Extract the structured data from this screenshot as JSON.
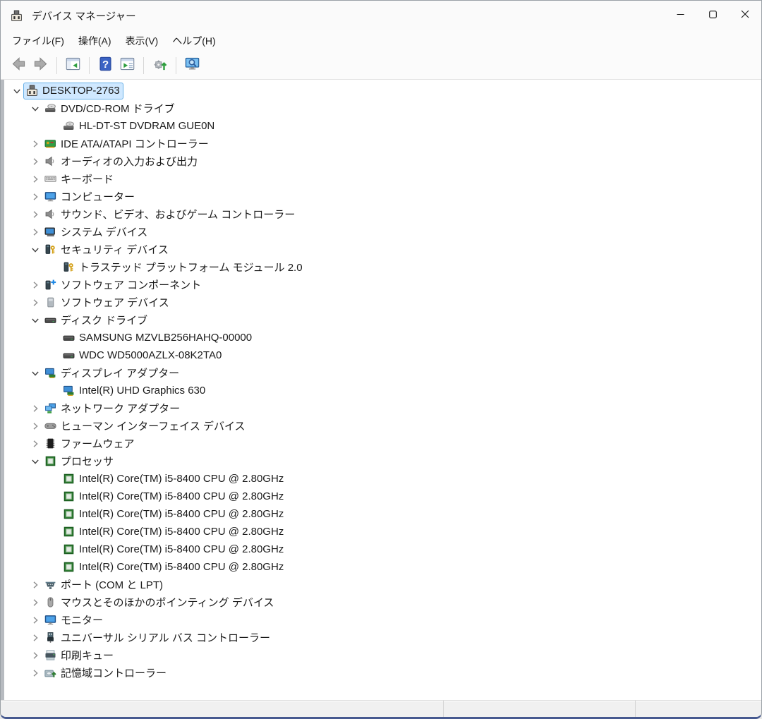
{
  "window": {
    "title": "デバイス マネージャー",
    "controls": [
      {
        "name": "minimize-button",
        "icon": "minimize-icon"
      },
      {
        "name": "maximize-button",
        "icon": "maximize-icon"
      },
      {
        "name": "close-button",
        "icon": "close-icon"
      }
    ]
  },
  "menu": {
    "items": [
      {
        "label": "ファイル(F)"
      },
      {
        "label": "操作(A)"
      },
      {
        "label": "表示(V)"
      },
      {
        "label": "ヘルプ(H)"
      }
    ]
  },
  "toolbar": {
    "items": [
      {
        "type": "button",
        "icon": "back-arrow-icon"
      },
      {
        "type": "button",
        "icon": "forward-arrow-icon"
      },
      {
        "type": "separator"
      },
      {
        "type": "button",
        "icon": "show-console-tree-icon"
      },
      {
        "type": "separator"
      },
      {
        "type": "button",
        "icon": "help-icon"
      },
      {
        "type": "button",
        "icon": "properties-icon"
      },
      {
        "type": "separator"
      },
      {
        "type": "button",
        "icon": "update-driver-icon"
      },
      {
        "type": "separator"
      },
      {
        "type": "button",
        "icon": "scan-hardware-changes-icon"
      }
    ]
  },
  "tree": {
    "items": [
      {
        "level": 0,
        "expander": "expanded",
        "icon": "computer-device-icon",
        "label": "DESKTOP-2763",
        "selected": true
      },
      {
        "level": 1,
        "expander": "expanded",
        "icon": "dvd-drive-icon",
        "label": "DVD/CD-ROM ドライブ"
      },
      {
        "level": 2,
        "expander": "none",
        "icon": "dvd-drive-icon",
        "label": "HL-DT-ST DVDRAM GUE0N"
      },
      {
        "level": 1,
        "expander": "collapsed",
        "icon": "ide-controller-icon",
        "label": "IDE ATA/ATAPI コントローラー"
      },
      {
        "level": 1,
        "expander": "collapsed",
        "icon": "speaker-icon",
        "label": "オーディオの入力および出力"
      },
      {
        "level": 1,
        "expander": "collapsed",
        "icon": "keyboard-icon",
        "label": "キーボード"
      },
      {
        "level": 1,
        "expander": "collapsed",
        "icon": "blue-monitor-icon",
        "label": "コンピューター"
      },
      {
        "level": 1,
        "expander": "collapsed",
        "icon": "speaker-icon",
        "label": "サウンド、ビデオ、およびゲーム コントローラー"
      },
      {
        "level": 1,
        "expander": "collapsed",
        "icon": "system-device-icon",
        "label": "システム デバイス"
      },
      {
        "level": 1,
        "expander": "expanded",
        "icon": "security-device-icon",
        "label": "セキュリティ デバイス"
      },
      {
        "level": 2,
        "expander": "none",
        "icon": "security-device-icon",
        "label": "トラステッド プラットフォーム モジュール 2.0"
      },
      {
        "level": 1,
        "expander": "collapsed",
        "icon": "software-component-icon",
        "label": "ソフトウェア コンポーネント"
      },
      {
        "level": 1,
        "expander": "collapsed",
        "icon": "software-device-icon",
        "label": "ソフトウェア デバイス"
      },
      {
        "level": 1,
        "expander": "expanded",
        "icon": "disk-drive-icon",
        "label": "ディスク ドライブ"
      },
      {
        "level": 2,
        "expander": "none",
        "icon": "disk-drive-icon",
        "label": "SAMSUNG MZVLB256HAHQ-00000"
      },
      {
        "level": 2,
        "expander": "none",
        "icon": "disk-drive-icon",
        "label": "WDC WD5000AZLX-08K2TA0"
      },
      {
        "level": 1,
        "expander": "expanded",
        "icon": "display-adapter-icon",
        "label": "ディスプレイ アダプター"
      },
      {
        "level": 2,
        "expander": "none",
        "icon": "display-adapter-icon",
        "label": "Intel(R) UHD Graphics 630"
      },
      {
        "level": 1,
        "expander": "collapsed",
        "icon": "network-adapter-icon",
        "label": "ネットワーク アダプター"
      },
      {
        "level": 1,
        "expander": "collapsed",
        "icon": "hid-icon",
        "label": "ヒューマン インターフェイス デバイス"
      },
      {
        "level": 1,
        "expander": "collapsed",
        "icon": "firmware-chip-icon",
        "label": "ファームウェア"
      },
      {
        "level": 1,
        "expander": "expanded",
        "icon": "processor-icon",
        "label": "プロセッサ"
      },
      {
        "level": 2,
        "expander": "none",
        "icon": "processor-icon",
        "label": "Intel(R) Core(TM) i5-8400 CPU @ 2.80GHz"
      },
      {
        "level": 2,
        "expander": "none",
        "icon": "processor-icon",
        "label": "Intel(R) Core(TM) i5-8400 CPU @ 2.80GHz"
      },
      {
        "level": 2,
        "expander": "none",
        "icon": "processor-icon",
        "label": "Intel(R) Core(TM) i5-8400 CPU @ 2.80GHz"
      },
      {
        "level": 2,
        "expander": "none",
        "icon": "processor-icon",
        "label": "Intel(R) Core(TM) i5-8400 CPU @ 2.80GHz"
      },
      {
        "level": 2,
        "expander": "none",
        "icon": "processor-icon",
        "label": "Intel(R) Core(TM) i5-8400 CPU @ 2.80GHz"
      },
      {
        "level": 2,
        "expander": "none",
        "icon": "processor-icon",
        "label": "Intel(R) Core(TM) i5-8400 CPU @ 2.80GHz"
      },
      {
        "level": 1,
        "expander": "collapsed",
        "icon": "serial-port-icon",
        "label": "ポート (COM と LPT)"
      },
      {
        "level": 1,
        "expander": "collapsed",
        "icon": "mouse-icon",
        "label": "マウスとそのほかのポインティング デバイス"
      },
      {
        "level": 1,
        "expander": "collapsed",
        "icon": "blue-monitor-icon",
        "label": "モニター"
      },
      {
        "level": 1,
        "expander": "collapsed",
        "icon": "usb-icon",
        "label": "ユニバーサル シリアル バス コントローラー"
      },
      {
        "level": 1,
        "expander": "collapsed",
        "icon": "print-queue-icon",
        "label": "印刷キュー"
      },
      {
        "level": 1,
        "expander": "collapsed",
        "icon": "storage-controller-icon",
        "label": "記憶域コントローラー"
      }
    ]
  },
  "statusbar": {
    "panels": [
      "",
      "",
      ""
    ]
  },
  "colors": {
    "selection_bg": "#cfe8ff",
    "selection_border": "#67b0e8",
    "window_bottom_border": "#46598f",
    "processor_green": "#2e7d32",
    "help_blue": "#3b63c4"
  }
}
